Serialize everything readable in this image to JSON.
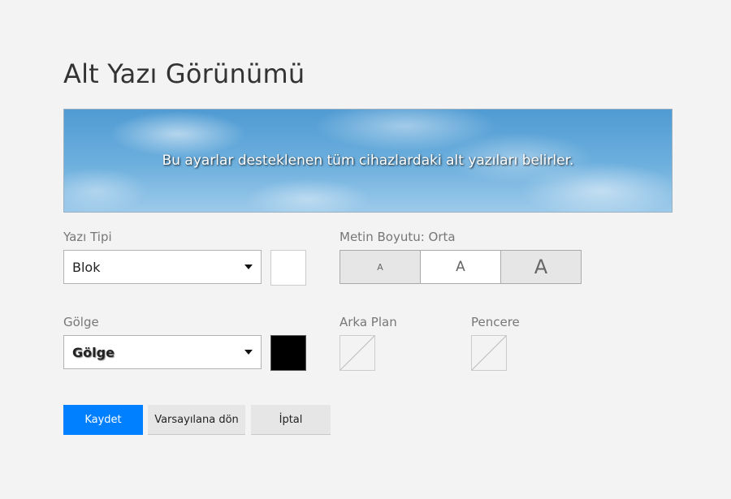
{
  "page": {
    "title": "Alt Yazı Görünümü"
  },
  "preview": {
    "text": "Bu ayarlar desteklenen tüm cihazlardaki alt yazıları belirler."
  },
  "font": {
    "label": "Yazı Tipi",
    "value": "Blok",
    "color": "#ffffff"
  },
  "text_size": {
    "label": "Metin Boyutu: Orta",
    "options": [
      "A",
      "A",
      "A"
    ],
    "selected_index": 1
  },
  "shadow": {
    "label": "Gölge",
    "value": "Gölge",
    "color": "#000000"
  },
  "background": {
    "label": "Arka Plan",
    "value": "none"
  },
  "window": {
    "label": "Pencere",
    "value": "none"
  },
  "actions": {
    "save_label": "Kaydet",
    "default_label": "Varsayılana dön",
    "cancel_label": "İptal"
  },
  "colors": {
    "primary_button": "#0080ff",
    "page_background": "#f3f3f3"
  }
}
